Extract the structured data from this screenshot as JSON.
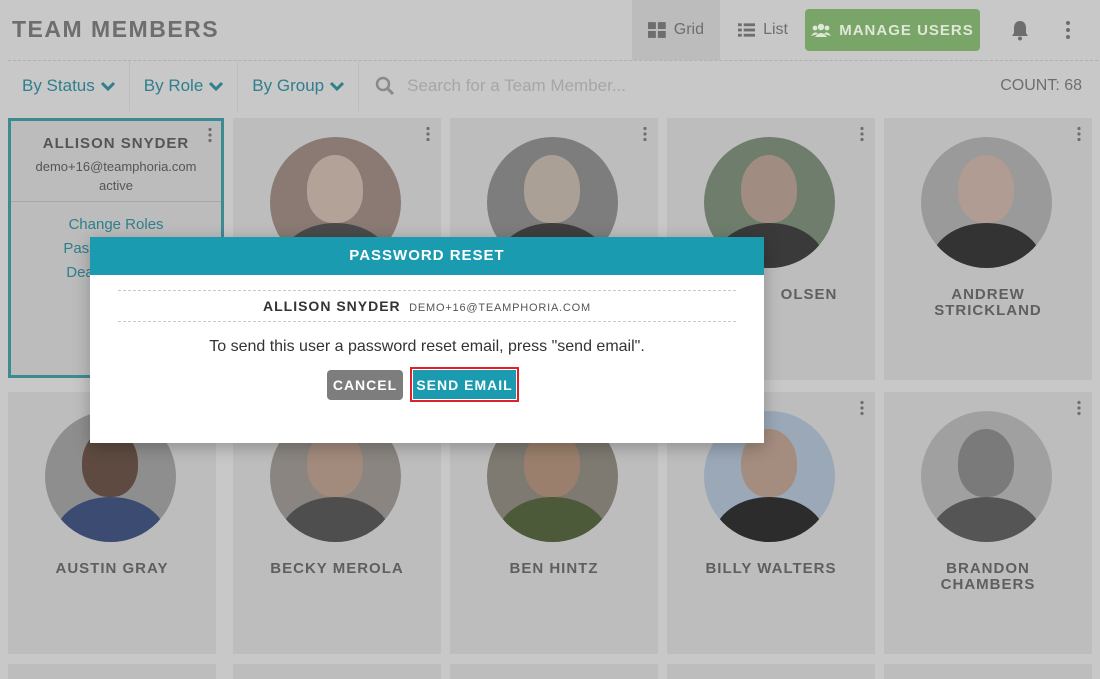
{
  "header": {
    "title": "TEAM MEMBERS",
    "view_grid_label": "Grid",
    "view_list_label": "List",
    "manage_users_label": "MANAGE USERS"
  },
  "filters": {
    "status_label": "By Status",
    "role_label": "By Role",
    "group_label": "By Group",
    "search_placeholder": "Search for a Team Member...",
    "count_label": "COUNT: 68"
  },
  "selected_card": {
    "name": "ALLISON SNYDER",
    "email": "demo+16@teamphoria.com",
    "status": "active",
    "menu": [
      "Change Roles",
      "Pass",
      "Dea"
    ]
  },
  "members": [
    {
      "name": ""
    },
    {
      "name": ""
    },
    {
      "name": "OLSEN"
    },
    {
      "name": "ANDREW STRICKLAND"
    },
    {
      "name": "AUSTIN GRAY"
    },
    {
      "name": "BECKY MEROLA"
    },
    {
      "name": "BEN HINTZ"
    },
    {
      "name": "BILLY WALTERS"
    },
    {
      "name": "BRANDON CHAMBERS"
    }
  ],
  "modal": {
    "title": "PASSWORD RESET",
    "user_name": "ALLISON SNYDER",
    "user_email": "DEMO+16@TEAMPHORIA.COM",
    "message": "To send this user a password reset email, press \"send email\".",
    "cancel_label": "CANCEL",
    "send_label": "SEND EMAIL"
  },
  "colors": {
    "accent": "#1a9bb0",
    "manage_button": "#7aa568",
    "highlight_border": "#e0202a",
    "overlay_bg": "#c8c8c8"
  }
}
